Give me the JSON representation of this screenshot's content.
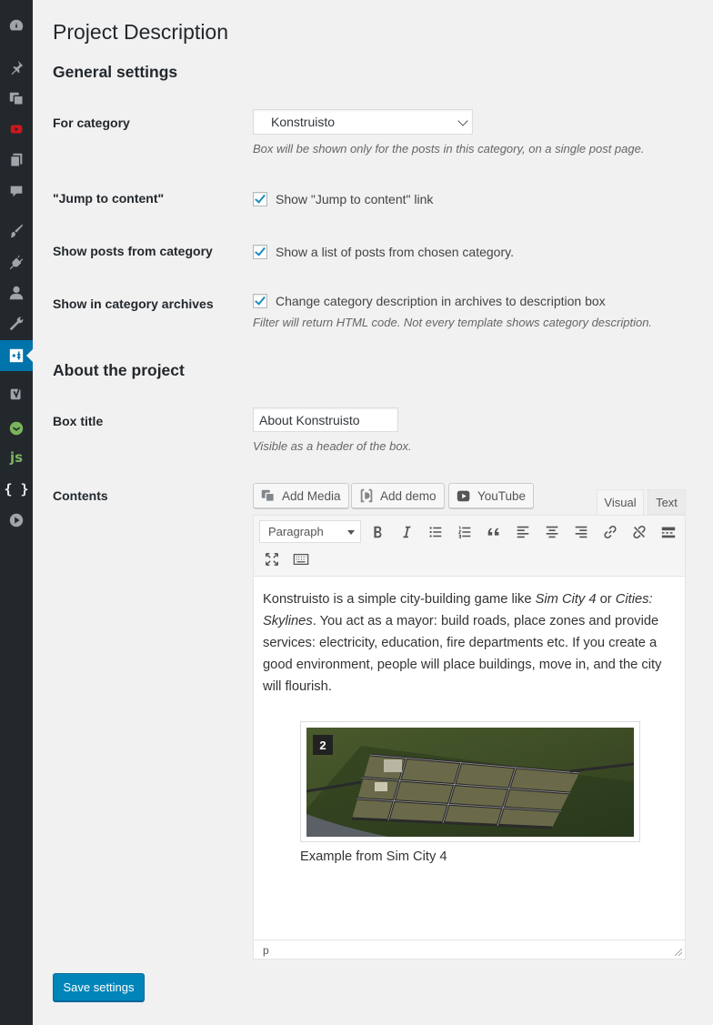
{
  "sidebar": {
    "icons": [
      "dashboard-icon",
      "pin-icon",
      "media-icon",
      "youtube-icon",
      "pages-icon",
      "comments-icon",
      "brush-icon",
      "plugins-icon",
      "users-icon",
      "tools-icon",
      "project-icon",
      "yoast-icon",
      "wpforms-icon",
      "js-icon",
      "braces-icon",
      "play-icon"
    ],
    "braces_text": "{ }",
    "js_text": "js"
  },
  "page_title": "Project Description",
  "general": {
    "heading": "General settings",
    "category_label": "For category",
    "category_value": "Konstruisto",
    "category_desc": "Box will be shown only for the posts in this category, on a single post page.",
    "jump_label": "\"Jump to content\"",
    "jump_check": "Show \"Jump to content\" link",
    "posts_label": "Show posts from category",
    "posts_check": "Show a list of posts from chosen category.",
    "archives_label": "Show in category archives",
    "archives_check": "Change category description in archives to description box",
    "archives_desc": "Filter will return HTML code. Not every template shows category description."
  },
  "about": {
    "heading": "About the project",
    "title_label": "Box title",
    "title_value": "About Konstruisto",
    "title_desc": "Visible as a header of the box.",
    "contents_label": "Contents"
  },
  "editor": {
    "add_media": "Add Media",
    "add_demo": "Add demo",
    "youtube": "YouTube",
    "tab_visual": "Visual",
    "tab_text": "Text",
    "format": "Paragraph",
    "content": {
      "p1": "Konstruisto is a simple city-building game like ",
      "em1": "Sim City 4",
      "p2": " or ",
      "em2": "Cities: Skylines",
      "p3": ". You act as a mayor: build roads, place zones and provide services: electricity, education, fire departments etc. If you create a good environment, people will place buildings, move in, and the city will flourish."
    },
    "image_badge": "2",
    "caption": "Example from Sim City 4",
    "status_path": "p"
  },
  "save_label": "Save settings",
  "colors": {
    "accent": "#0073aa",
    "button": "#0085ba",
    "sidebar": "#23282d"
  }
}
